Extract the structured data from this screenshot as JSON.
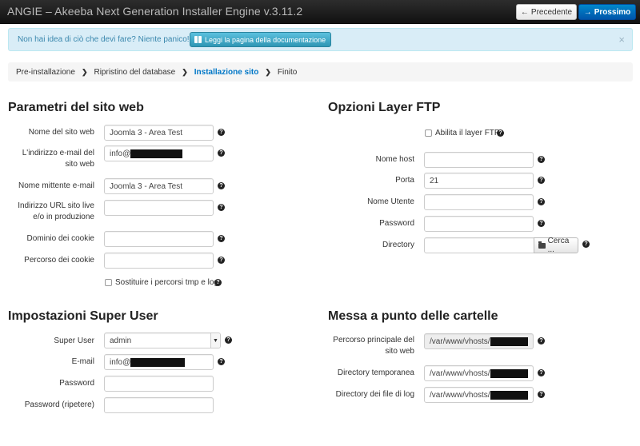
{
  "header": {
    "title": "ANGIE – Akeeba Next Generation Installer Engine v.3.11.2",
    "prev_label": "Precedente",
    "next_label": "Prossimo"
  },
  "alert": {
    "text": "Non hai idea di ciò che devi fare? Niente panico!",
    "doc_button": "Leggi la pagina della documentazione",
    "close": "×"
  },
  "breadcrumb": {
    "steps": [
      "Pre-installazione",
      "Ripristino del database",
      "Installazione sito",
      "Finito"
    ],
    "active_index": 2
  },
  "site_params": {
    "title": "Parametri del sito web",
    "site_name_label": "Nome del sito web",
    "site_name_value": "Joomla 3 - Area Test",
    "email_label": "L'indirizzo e-mail del sito web",
    "email_value": "info@",
    "sender_label": "Nome mittente e-mail",
    "sender_value": "Joomla 3 - Area Test",
    "live_url_label": "Indirizzo URL sito live e/o in produzione",
    "live_url_value": "",
    "cookie_domain_label": "Dominio dei cookie",
    "cookie_domain_value": "",
    "cookie_path_label": "Percorso dei cookie",
    "cookie_path_value": "",
    "replace_paths_label": "Sostituire i percorsi tmp e log"
  },
  "ftp": {
    "title": "Opzioni Layer FTP",
    "enable_label": "Abilita il layer FTP",
    "host_label": "Nome host",
    "host_value": "",
    "port_label": "Porta",
    "port_value": "21",
    "user_label": "Nome Utente",
    "user_value": "",
    "password_label": "Password",
    "password_value": "",
    "directory_label": "Directory",
    "directory_value": "",
    "browse_label": "Cerca ..."
  },
  "super_user": {
    "title": "Impostazioni Super User",
    "user_label": "Super User",
    "user_value": "admin",
    "email_label": "E-mail",
    "email_value": "info@",
    "password_label": "Password",
    "password_repeat_label": "Password (ripetere)"
  },
  "folders": {
    "title": "Messa a punto delle cartelle",
    "root_label": "Percorso principale del sito web",
    "root_value": "/var/www/vhosts/",
    "tmp_label": "Directory temporanea",
    "tmp_value": "/var/www/vhosts/",
    "log_label": "Directory dei file di log",
    "log_value": "/var/www/vhosts/"
  },
  "colors": {
    "accent": "#0077c7",
    "alert_bg": "#d9edf7",
    "alert_text": "#3a87ad",
    "topbar": "#1a1a1a"
  },
  "icons": {
    "help": "question-circle-icon",
    "prev": "arrow-left-icon",
    "next": "arrow-right-icon",
    "doc": "book-icon",
    "browse": "folder-open-icon"
  }
}
